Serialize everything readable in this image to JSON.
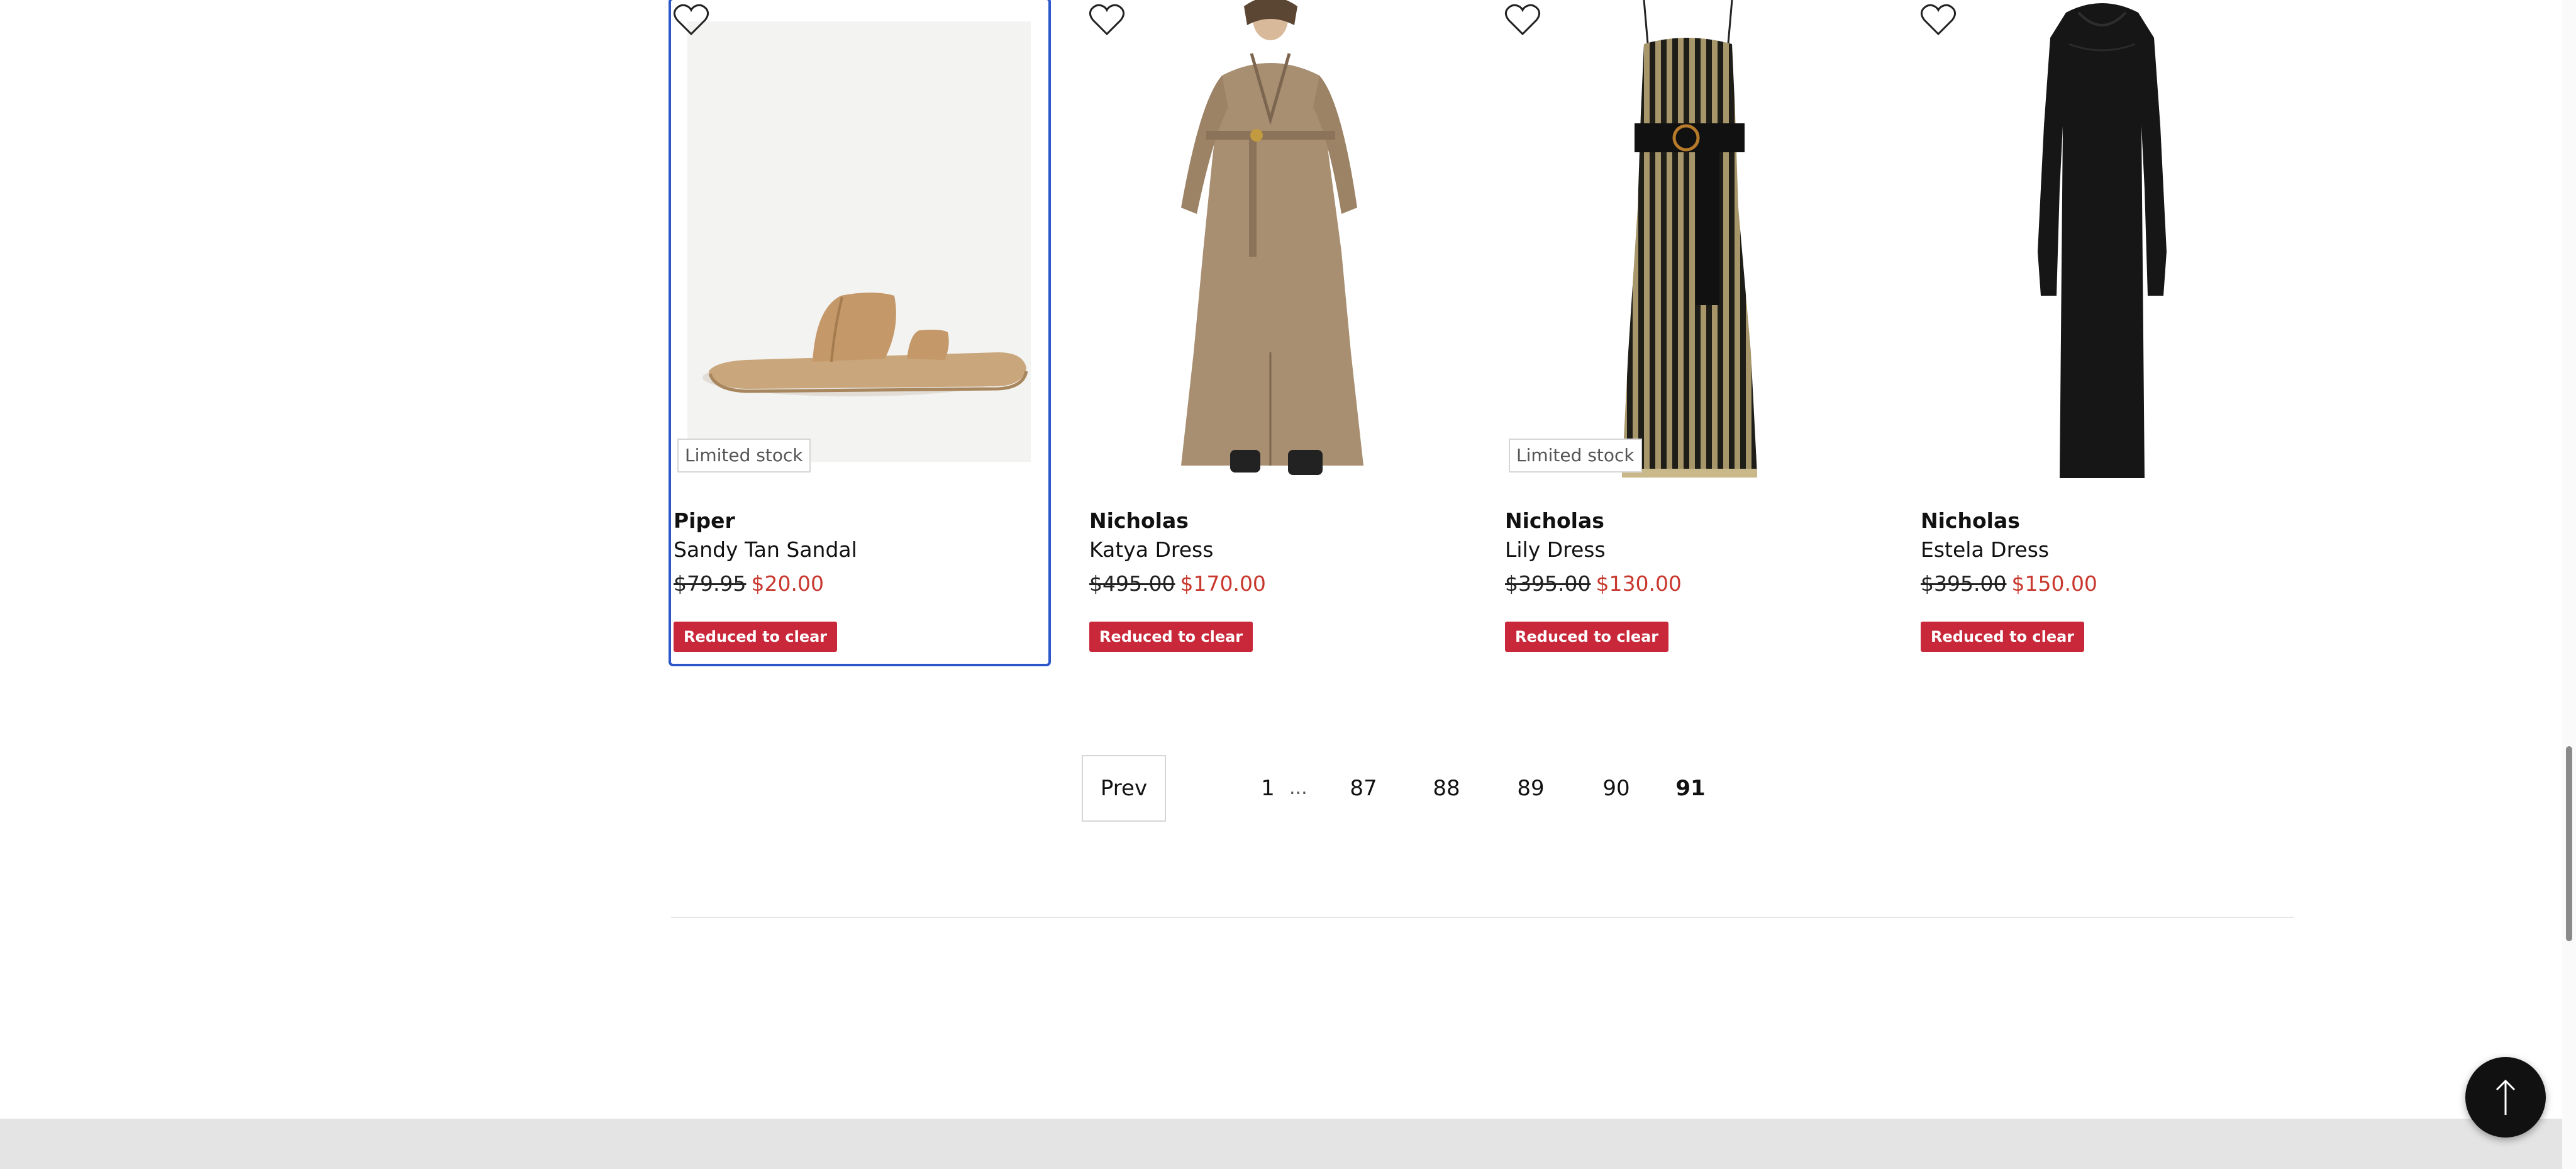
{
  "products": [
    {
      "brand": "Piper",
      "name": "Sandy Tan Sandal",
      "old_price": "$79.95",
      "new_price": "$20.00",
      "promo": "Reduced to clear",
      "stock_badge": "Limited stock",
      "image_icon": "sandal-image"
    },
    {
      "brand": "Nicholas",
      "name": "Katya Dress",
      "old_price": "$495.00",
      "new_price": "$170.00",
      "promo": "Reduced to clear",
      "stock_badge": "",
      "image_icon": "belted-dress-image"
    },
    {
      "brand": "Nicholas",
      "name": "Lily Dress",
      "old_price": "$395.00",
      "new_price": "$130.00",
      "promo": "Reduced to clear",
      "stock_badge": "Limited stock",
      "image_icon": "striped-dress-image"
    },
    {
      "brand": "Nicholas",
      "name": "Estela Dress",
      "old_price": "$395.00",
      "new_price": "$150.00",
      "promo": "Reduced to clear",
      "stock_badge": "",
      "image_icon": "black-dress-image"
    }
  ],
  "pagination": {
    "prev_label": "Prev",
    "first": "1",
    "ellipsis": "...",
    "pages": [
      "87",
      "88",
      "89",
      "90",
      "91"
    ],
    "current": "91"
  },
  "icons": {
    "wishlist": "heart-icon",
    "back_to_top": "arrow-up-icon"
  },
  "colors": {
    "sale_price": "#c8382e",
    "promo_badge": "#c8283a",
    "focus_outline": "#2b57c9"
  }
}
